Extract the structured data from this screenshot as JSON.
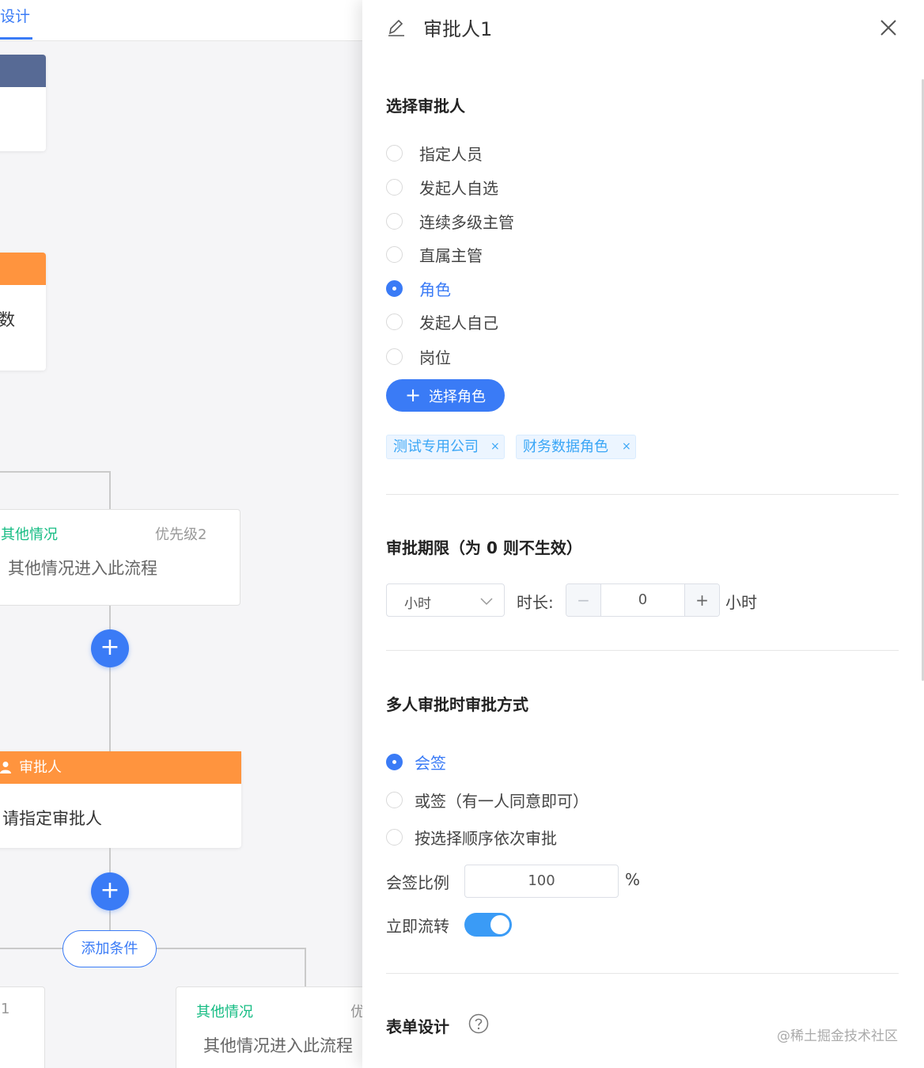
{
  "canvas": {
    "tab_label": "设计",
    "node_cut_text": "数",
    "branch1": {
      "title": "其他情况",
      "priority": "优先级2",
      "text": "其他情况进入此流程"
    },
    "approver": {
      "title": "审批人",
      "text": "请指定审批人"
    },
    "add_condition_label": "添加条件",
    "branch_bottom_left": {
      "title_cut": "1"
    },
    "branch2": {
      "title": "其他情况",
      "priority_cut": "优",
      "text": "其他情况进入此流程"
    },
    "add_icon_glyph": "+"
  },
  "drawer": {
    "title": "审批人1",
    "select_approver": {
      "heading": "选择审批人",
      "options": [
        "指定人员",
        "发起人自选",
        "连续多级主管",
        "直属主管",
        "角色",
        "发起人自己",
        "岗位"
      ],
      "selected": "角色",
      "button_label": "选择角色",
      "button_icon": "+",
      "tags": [
        "测试专用公司",
        "财务数据角色"
      ],
      "tag_close": "×"
    },
    "deadline": {
      "heading": "审批期限（为 0 则不生效）",
      "unit": "小时",
      "duration_label": "时长:",
      "value": "0",
      "minus": "−",
      "plus": "+",
      "suffix": "小时"
    },
    "multi": {
      "heading": "多人审批时审批方式",
      "options": [
        "会签",
        "或签（有一人同意即可）",
        "按选择顺序依次审批"
      ],
      "selected": "会签",
      "ratio_label": "会签比例",
      "ratio_value": "100",
      "ratio_unit": "%",
      "immediate_label": "立即流转",
      "immediate_on": true
    },
    "form": {
      "heading": "表单设计"
    },
    "watermark": "@稀土掘金技术社区"
  },
  "colors": {
    "accent": "#3a7bf6",
    "orange": "#ff943e",
    "slate": "#576a95",
    "green": "#15bc83",
    "tag_text": "#3aa6f6"
  }
}
